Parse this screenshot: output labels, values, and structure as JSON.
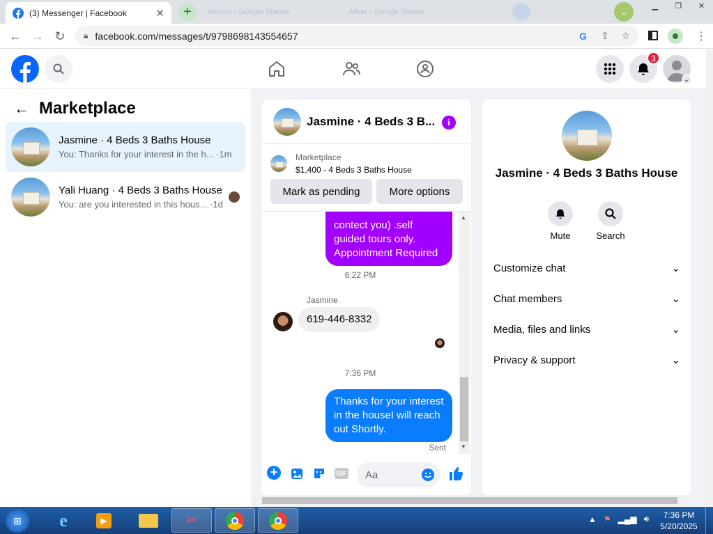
{
  "browser": {
    "active_tab_title": "(3) Messenger | Facebook",
    "other_tabs": [
      "Vendor - Google Sheets",
      "Aftrer - Google Sheets"
    ],
    "url": "facebook.com/messages/t/9798698143554657"
  },
  "header": {
    "notification_count": "3"
  },
  "left": {
    "title": "Marketplace",
    "conversations": [
      {
        "name": "Jasmine · 4 Beds 3 Baths House",
        "last": "You: Thanks for your interest in the h...",
        "time": "·1m"
      },
      {
        "name": "Yali Huang · 4 Beds 3 Baths House",
        "last": "You: are you interested in this hous...",
        "time": "·1d"
      }
    ]
  },
  "chat": {
    "title": "Jasmine · 4 Beds 3 B...",
    "listing_source": "Marketplace",
    "listing_desc": "$1,400 - 4 Beds 3 Baths House",
    "mark_pending": "Mark as pending",
    "more_options": "More options",
    "msg_partial": "contect you) .self guided tours only. Appointment Required",
    "time1": "6:22 PM",
    "sender": "Jasmine",
    "msg_phone": "619-446-8332",
    "time2": "7:36 PM",
    "msg_last": "Thanks for your interest in the houseI will reach out Shortly.",
    "status": "Sent",
    "input_placeholder": "Aa"
  },
  "right": {
    "name": "Jasmine · 4 Beds 3 Baths House",
    "mute": "Mute",
    "search": "Search",
    "menu": [
      "Customize chat",
      "Chat members",
      "Media, files and links",
      "Privacy & support"
    ]
  },
  "taskbar": {
    "time": "7:36 PM",
    "date": "5/20/2025"
  },
  "colors": {
    "fb_blue": "#0866ff",
    "messenger_blue": "#0a7cff",
    "purple": "#a100ff"
  }
}
